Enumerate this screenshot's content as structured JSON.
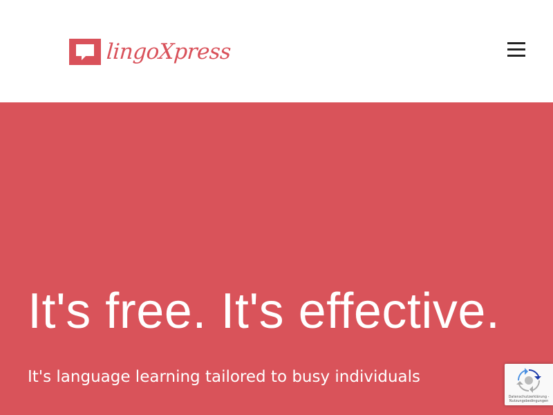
{
  "header": {
    "logo_text": "lingoXpress",
    "menu_icon": "hamburger-menu-icon"
  },
  "hero": {
    "title": "It's free. It's effective.",
    "subtitle": "It's language learning tailored to busy individuals"
  },
  "recaptcha": {
    "privacy_link": "Datenschutzerklärung -",
    "terms_link": "Nutzungsbedingungen"
  },
  "colors": {
    "brand": "#d9515a",
    "hero_background": "#d9535a",
    "header_background": "#ffffff",
    "text_on_brand": "#ffffff"
  }
}
